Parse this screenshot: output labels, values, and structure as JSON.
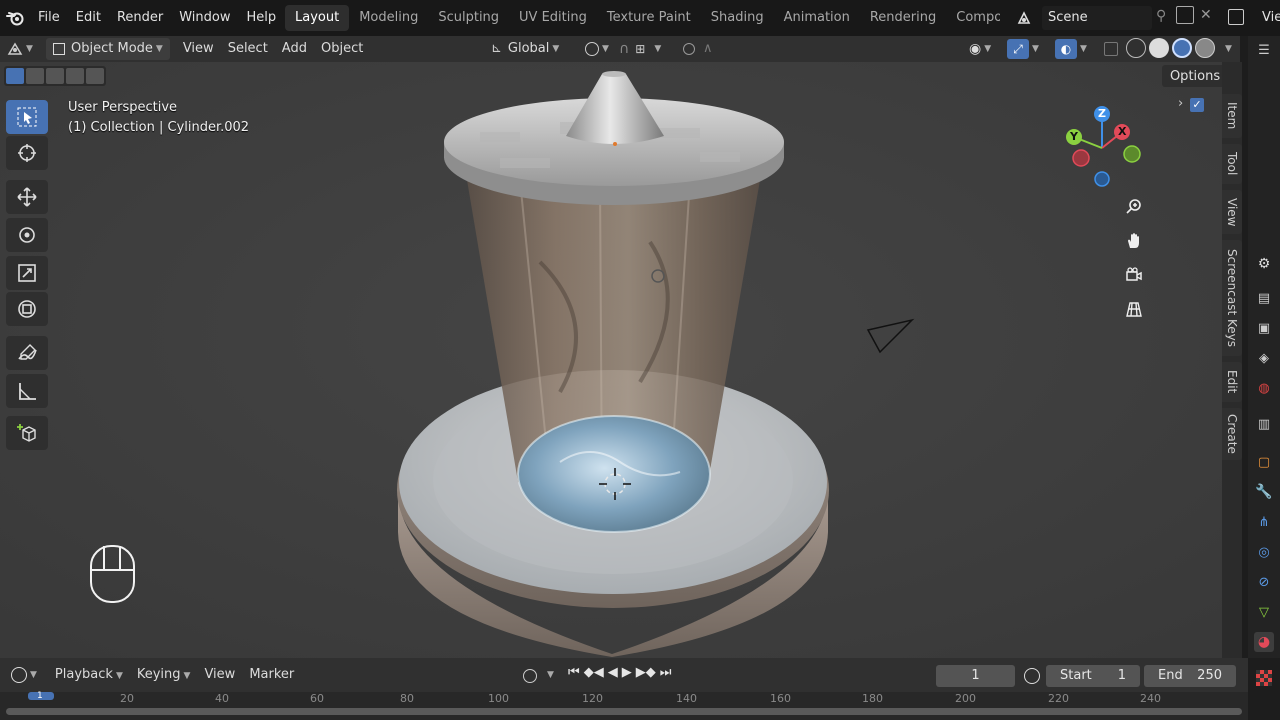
{
  "menu": [
    "File",
    "Edit",
    "Render",
    "Window",
    "Help"
  ],
  "workspace_tabs": [
    "Layout",
    "Modeling",
    "Sculpting",
    "UV Editing",
    "Texture Paint",
    "Shading",
    "Animation",
    "Rendering",
    "Compositing"
  ],
  "active_workspace": "Layout",
  "scene": {
    "name": "Scene"
  },
  "top_right_label": "Vie",
  "viewport_header": {
    "mode": "Object Mode",
    "menus": [
      "View",
      "Select",
      "Add",
      "Object"
    ],
    "transform_orientation": "Global",
    "options_label": "Options"
  },
  "viewport": {
    "view_name": "User Perspective",
    "collection_info": "(1) Collection | Cylinder.002"
  },
  "gizmo": {
    "x": "X",
    "y": "Y",
    "z": "Z"
  },
  "n_panel_tabs": [
    "Item",
    "Tool",
    "View",
    "Screencast Keys",
    "Edit",
    "Create"
  ],
  "timeline": {
    "menus": [
      "Playback",
      "Keying",
      "View",
      "Marker"
    ],
    "current_frame": "1",
    "start_label": "Start",
    "start_value": "1",
    "end_label": "End",
    "end_value": "250",
    "ruler": [
      "1",
      "20",
      "40",
      "60",
      "80",
      "100",
      "120",
      "140",
      "160",
      "180",
      "200",
      "220",
      "240"
    ]
  },
  "colors": {
    "accent": "#4772b3",
    "axis_x": "#e24a59",
    "axis_y": "#8bd140",
    "axis_z": "#3f90e8"
  }
}
